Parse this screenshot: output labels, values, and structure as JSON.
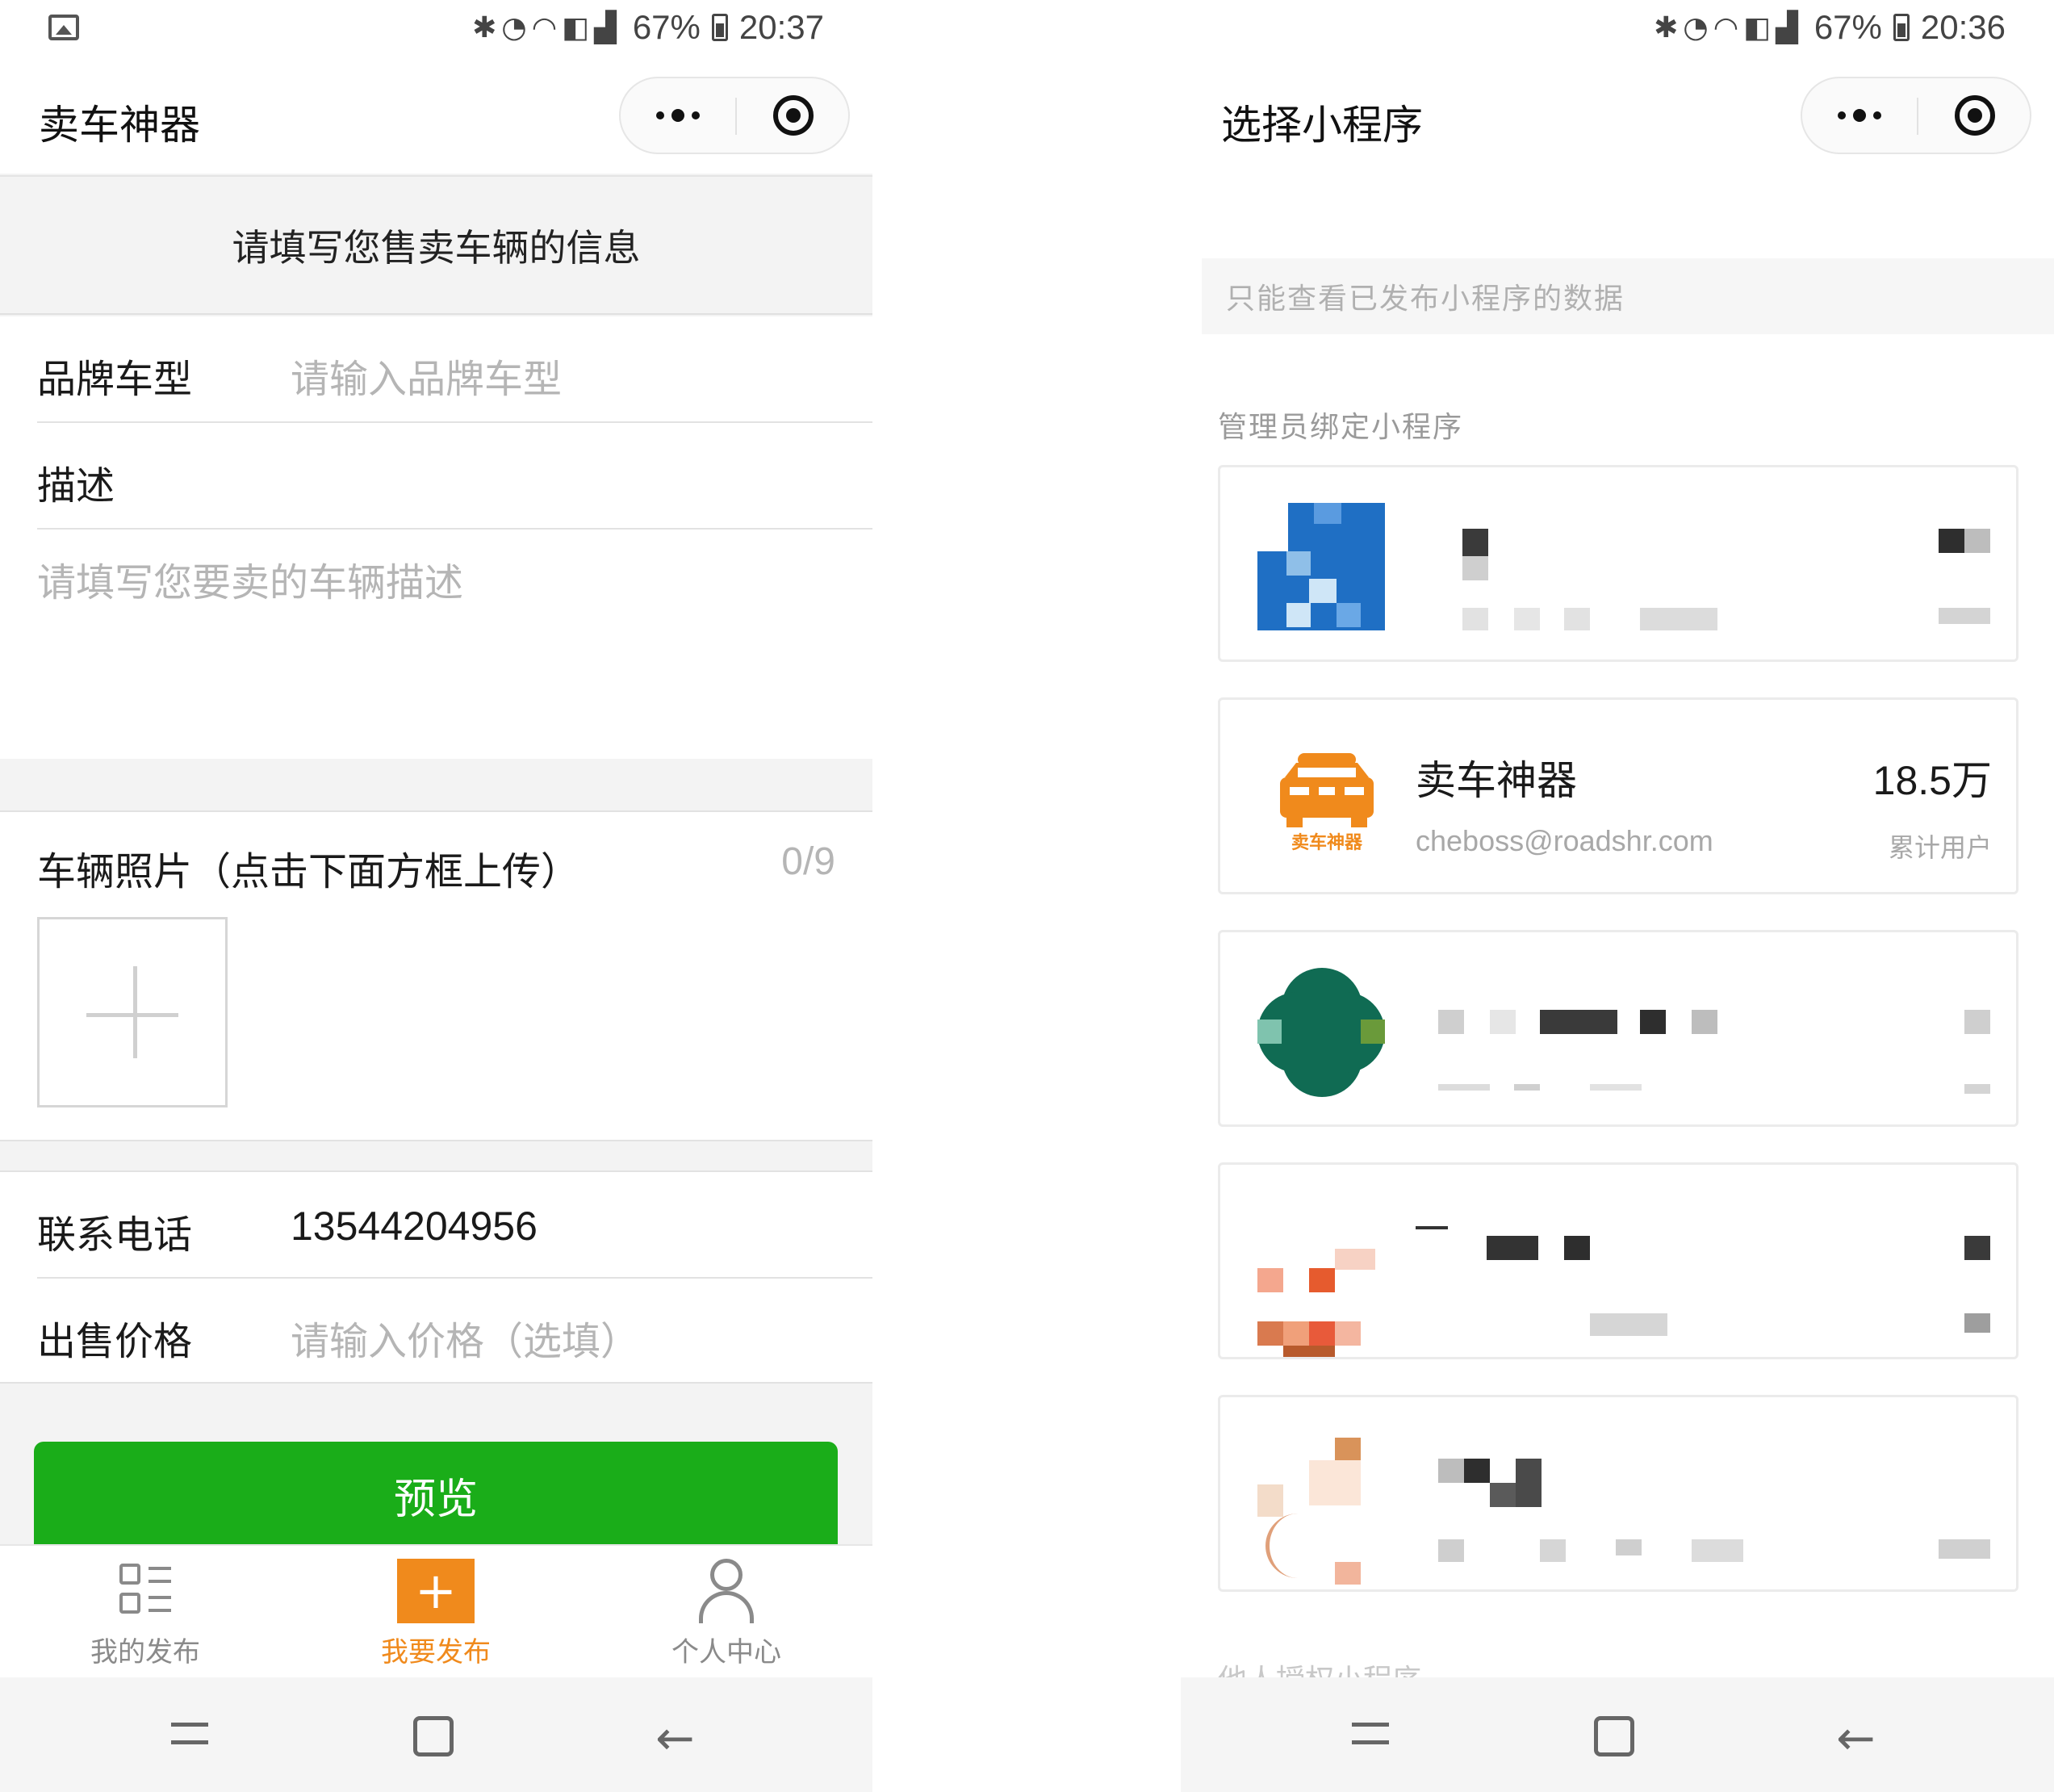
{
  "left": {
    "status_bar": {
      "battery": "67%",
      "time": "20:37"
    },
    "nav_title": "卖车神器",
    "form_header": "请填写您售卖车辆的信息",
    "brand_row": {
      "label": "品牌车型",
      "placeholder": "请输入品牌车型"
    },
    "desc_row": {
      "label": "描述",
      "placeholder": "请填写您要卖的车辆描述"
    },
    "photos": {
      "title": "车辆照片（点击下面方框上传）",
      "count": "0/9"
    },
    "phone_row": {
      "label": "联系电话",
      "value": "13544204956"
    },
    "price_row": {
      "label": "出售价格",
      "placeholder": "请输入价格（选填）"
    },
    "preview_button": "预览",
    "tabs": [
      {
        "label": "我的发布",
        "icon": "list-icon"
      },
      {
        "label": "我要发布",
        "icon": "plus-icon"
      },
      {
        "label": "个人中心",
        "icon": "user-icon"
      }
    ]
  },
  "right": {
    "status_bar": {
      "battery": "67%",
      "time": "20:36"
    },
    "nav_title": "选择小程序",
    "notice": "只能查看已发布小程序的数据",
    "section_title": "管理员绑定小程序",
    "featured_card": {
      "name": "卖车神器",
      "email": "cheboss@roadshr.com",
      "stat_value": "18.5万",
      "stat_label": "累计用户",
      "logo_text": "卖车神器"
    },
    "next_section_partial": "他人授权小程序"
  },
  "colors": {
    "primary_green": "#1aad19",
    "accent_orange": "#f08a1c",
    "page_gray": "#f3f3f3"
  }
}
